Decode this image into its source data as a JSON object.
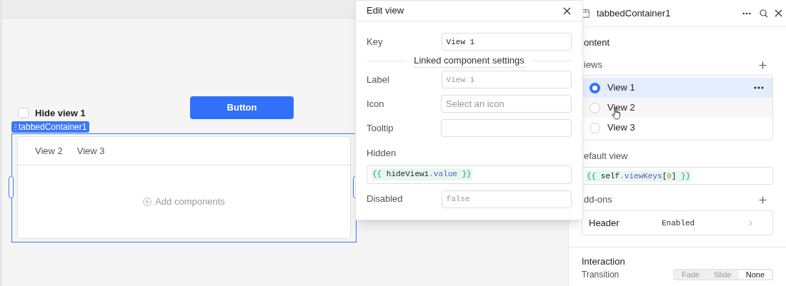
{
  "canvas": {
    "checkbox": {
      "label": "Hide view 1",
      "checked": false
    },
    "button": {
      "label": "Button"
    },
    "component_tag": "tabbedContainer1",
    "tabbed_container": {
      "tabs": [
        {
          "label": "View 2",
          "selected": false
        },
        {
          "label": "View 3",
          "selected": false
        }
      ],
      "empty_state": "Add components"
    }
  },
  "edit_view": {
    "title": "Edit view",
    "rows": [
      {
        "kind": "field",
        "label": "Key",
        "value": "View 1",
        "mono": true
      },
      {
        "kind": "divider",
        "label": "Linked component settings"
      },
      {
        "kind": "field",
        "label": "Label",
        "placeholder": "View 1",
        "mono": true
      },
      {
        "kind": "field",
        "label": "Icon",
        "placeholder": "Select an icon",
        "mono": false
      },
      {
        "kind": "field",
        "label": "Tooltip",
        "mono": false
      },
      {
        "kind": "code",
        "label": "Hidden",
        "value": "{{ hideView1.value }}"
      },
      {
        "kind": "field",
        "label": "Disabled",
        "placeholder": "false",
        "mono": true
      }
    ]
  },
  "inspector": {
    "title": "tabbedContainer1",
    "section": "ontent",
    "views": {
      "label": "iews",
      "items": [
        {
          "label": "View 1",
          "selected": true
        },
        {
          "label": "View 2",
          "selected": false
        },
        {
          "label": "View 3",
          "selected": false
        }
      ]
    },
    "default_view": {
      "label": "efault view",
      "value": "{{ self.viewKeys[0] }}"
    },
    "addons": {
      "label": "dd-ons",
      "items": [
        {
          "label": "Header",
          "value": "Enabled"
        }
      ]
    },
    "interaction": {
      "title": "Interaction",
      "transition": {
        "label": "Transition",
        "options": [
          {
            "label": "Fade",
            "selected": false
          },
          {
            "label": "Slide",
            "selected": false
          },
          {
            "label": "None",
            "selected": true
          }
        ]
      }
    }
  }
}
